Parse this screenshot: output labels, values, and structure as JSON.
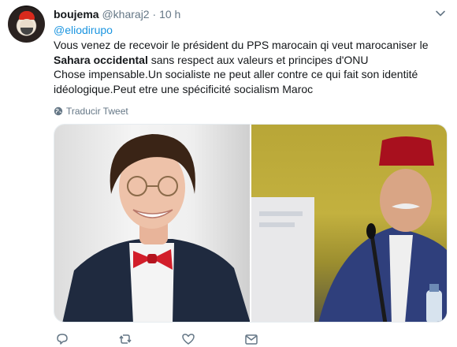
{
  "tweet": {
    "display_name": "boujema",
    "handle": "@kharaj2",
    "separator": "·",
    "time": "10 h",
    "reply_to": "@eliodirupo",
    "text_line1": "Vous venez de recevoir le président du PPS marocain qi veut marocaniser le",
    "text_bold": "Sahara occidental",
    "text_line2_rest": " sans respect aux valeurs et principes d'ONU",
    "text_line3": "Chose impensable.Un socialiste ne peut aller contre ce qui fait son identité",
    "text_line4": "idéologique.Peut etre une spécificité socialism Maroc",
    "translate_label": "Traducir Tweet"
  },
  "icons": {
    "menu": "chevron-down-icon",
    "translate": "globe-icon",
    "reply": "reply-icon",
    "retweet": "retweet-icon",
    "like": "heart-icon",
    "message": "envelope-icon"
  },
  "colors": {
    "link": "#1b95e0",
    "muted": "#657786",
    "text": "#14171a"
  }
}
